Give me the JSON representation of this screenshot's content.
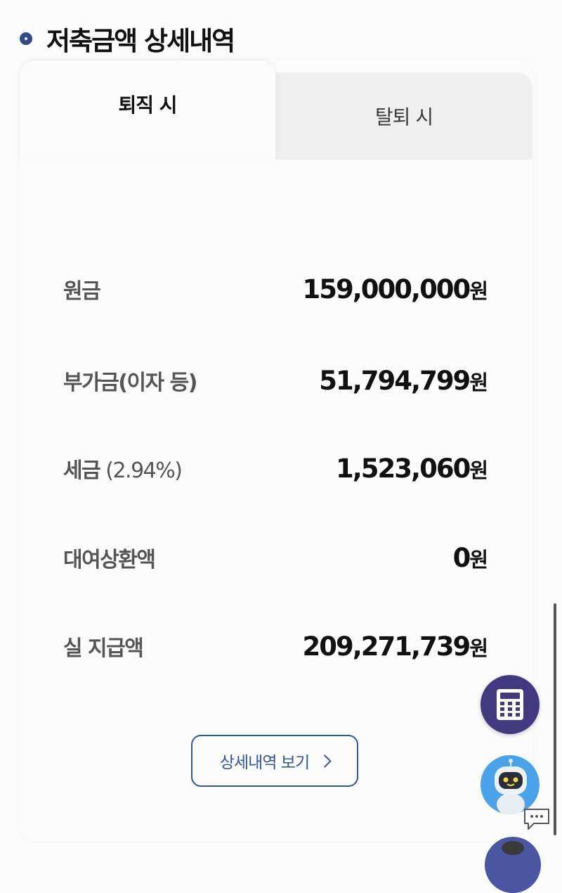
{
  "header": {
    "title": "저축금액 상세내역"
  },
  "tabs": [
    {
      "label": "퇴직 시",
      "active": true
    },
    {
      "label": "탈퇴 시",
      "active": false
    }
  ],
  "rows": [
    {
      "label": "원금",
      "label_sub": "",
      "value": "159,000,000",
      "unit": "원"
    },
    {
      "label": "부가금(이자 등)",
      "label_sub": "",
      "value": "51,794,799",
      "unit": "원"
    },
    {
      "label": "세금",
      "label_sub": " (2.94%)",
      "value": "1,523,060",
      "unit": "원"
    },
    {
      "label": "대여상환액",
      "label_sub": "",
      "value": "0",
      "unit": "원"
    },
    {
      "label": "실 지급액",
      "label_sub": "",
      "value": "209,271,739",
      "unit": "원"
    }
  ],
  "detail_button": {
    "label": "상세내역 보기"
  },
  "colors": {
    "accent": "#33579c",
    "title_ring": "#2f4a8c",
    "calc_fab": "#43397f",
    "bot_fab": "#4aa2ea"
  },
  "icons": {
    "title_ring": "ring-icon",
    "detail_chevron": "chevron-right-icon",
    "calculator": "calculator-icon",
    "chatbot": "robot-icon",
    "chat_bubble": "chat-bubble-icon"
  }
}
